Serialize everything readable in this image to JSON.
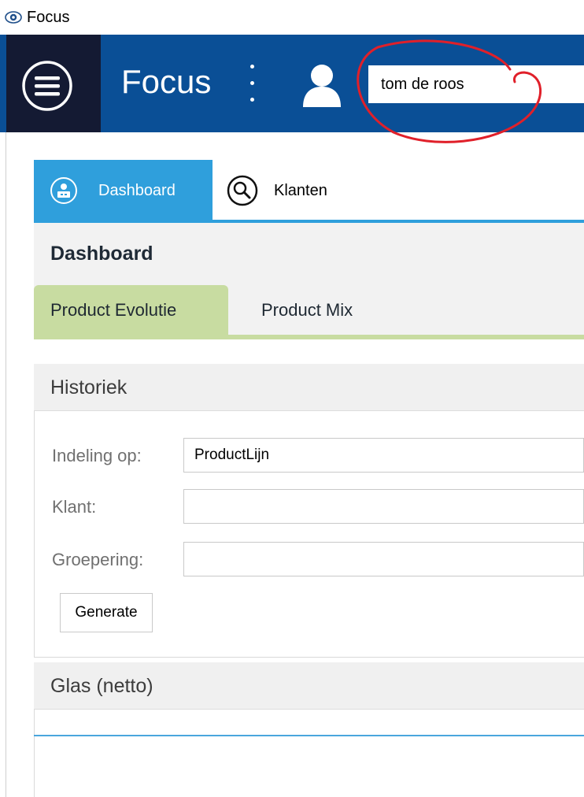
{
  "window": {
    "title": "Focus",
    "icon": "eye-icon"
  },
  "header": {
    "brand": "Focus",
    "menu_icon": "hamburger-menu-icon",
    "more_icon": "kebab-icon",
    "user_icon": "user-icon",
    "search_value": "tom de roos",
    "annotation_color": "#e0202a"
  },
  "nav": {
    "tabs": [
      {
        "label": "Dashboard",
        "icon": "dashboard-icon",
        "active": true
      },
      {
        "label": "Klanten",
        "icon": "search-icon",
        "active": false
      }
    ]
  },
  "dashboard": {
    "title": "Dashboard",
    "subtabs": [
      {
        "label": "Product Evolutie",
        "active": true
      },
      {
        "label": "Product Mix",
        "active": false
      }
    ]
  },
  "historiek": {
    "title": "Historiek",
    "fields": [
      {
        "label": "Indeling op:",
        "value": "ProductLijn"
      },
      {
        "label": "Klant:",
        "value": ""
      },
      {
        "label": "Groepering:",
        "value": ""
      }
    ],
    "generate_label": "Generate"
  },
  "glas": {
    "title": "Glas (netto)"
  },
  "colors": {
    "header_blue": "#0a4f96",
    "menu_dark": "#141a33",
    "tab_active_blue": "#2f9fdc",
    "subtab_green": "#c8dca1"
  }
}
